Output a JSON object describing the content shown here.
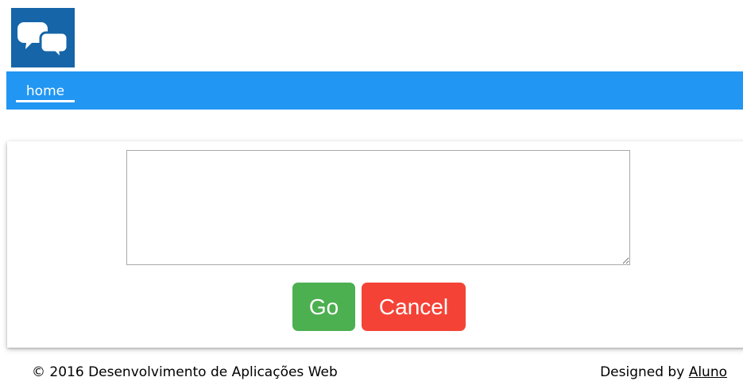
{
  "header": {
    "logo_icon": "chat-bubbles-icon",
    "logo_color": "#1565a8"
  },
  "nav": {
    "home_label": "home",
    "bar_color": "#2196f3"
  },
  "form": {
    "message_value": "",
    "go_label": "Go",
    "cancel_label": "Cancel",
    "go_color": "#4caf50",
    "cancel_color": "#f44336"
  },
  "footer": {
    "copyright": "© 2016 Desenvolvimento de Aplicações Web",
    "designed_by_prefix": "Designed by ",
    "designed_by_link": "Aluno"
  }
}
